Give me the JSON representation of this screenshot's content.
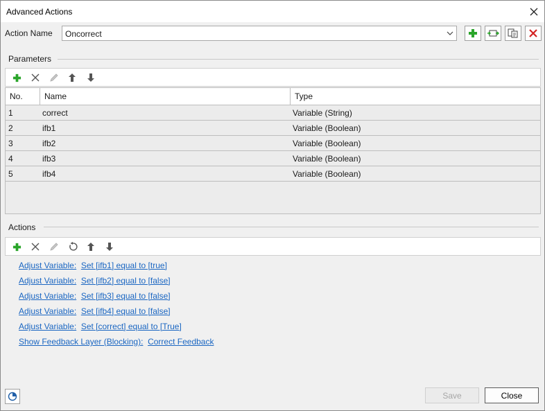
{
  "window": {
    "title": "Advanced Actions"
  },
  "action_name": {
    "label": "Action Name",
    "value": "Oncorrect"
  },
  "top_buttons": [
    {
      "icon": "add-icon"
    },
    {
      "icon": "import-export-icon"
    },
    {
      "icon": "duplicate-icon"
    },
    {
      "icon": "delete-icon"
    }
  ],
  "parameters": {
    "label": "Parameters",
    "columns": [
      "No.",
      "Name",
      "Type"
    ],
    "rows": [
      {
        "no": "1",
        "name": "correct",
        "type": "Variable (String)"
      },
      {
        "no": "2",
        "name": "ifb1",
        "type": "Variable (Boolean)"
      },
      {
        "no": "3",
        "name": "ifb2",
        "type": "Variable (Boolean)"
      },
      {
        "no": "4",
        "name": "ifb3",
        "type": "Variable (Boolean)"
      },
      {
        "no": "5",
        "name": "ifb4",
        "type": "Variable (Boolean)"
      }
    ]
  },
  "actions": {
    "label": "Actions",
    "items": [
      {
        "kind": "Adjust Variable:",
        "detail": "Set [ifb1] equal to [true]"
      },
      {
        "kind": "Adjust Variable:",
        "detail": "Set [ifb2] equal to [false]"
      },
      {
        "kind": "Adjust Variable:",
        "detail": "Set [ifb3] equal to [false]"
      },
      {
        "kind": "Adjust Variable:",
        "detail": "Set [ifb4] equal to [false]"
      },
      {
        "kind": "Adjust Variable:",
        "detail": "Set [correct] equal to [True]"
      },
      {
        "kind": "Show Feedback Layer (Blocking):",
        "detail": "Correct Feedback"
      }
    ]
  },
  "footer": {
    "save_label": "Save",
    "close_label": "Close"
  },
  "colors": {
    "accent_green": "#2aa52a",
    "delete_red": "#d42222",
    "link_blue": "#1a66c2"
  }
}
